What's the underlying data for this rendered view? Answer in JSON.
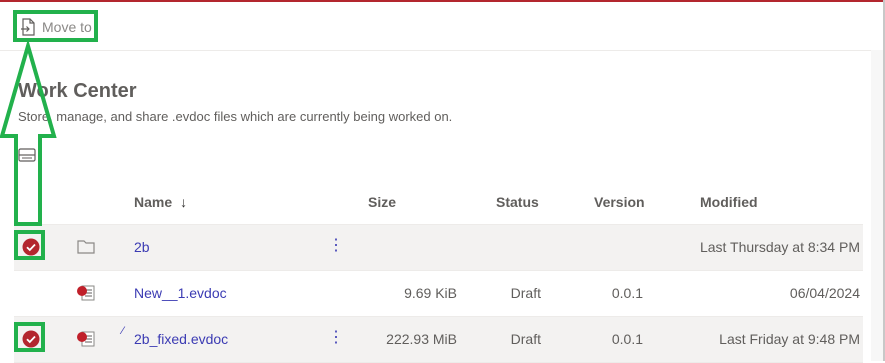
{
  "command_bar": {
    "move_to_label": "Move to"
  },
  "page": {
    "title": "Work Center",
    "subtitle": "Store, manage, and share .evdoc files which are currently being worked on."
  },
  "table": {
    "columns": {
      "name": "Name",
      "size": "Size",
      "status": "Status",
      "version": "Version",
      "modified": "Modified"
    },
    "sort_indicator": "↓",
    "rows": [
      {
        "name": "2b",
        "type": "folder",
        "size": "",
        "status": "",
        "version": "",
        "modified": "Last Thursday at 8:34 PM",
        "selected": true
      },
      {
        "name": "New__1.evdoc",
        "type": "evdoc",
        "size": "9.69 KiB",
        "status": "Draft",
        "version": "0.0.1",
        "modified": "06/04/2024",
        "selected": false
      },
      {
        "name": "2b_fixed.evdoc",
        "type": "evdoc",
        "size": "222.93 MiB",
        "status": "Draft",
        "version": "0.0.1",
        "modified": "Last Friday at 9:48 PM",
        "selected": true
      }
    ]
  },
  "colors": {
    "accent": "#b3262e",
    "link": "#3b3bb3",
    "annotation": "#22b14c"
  },
  "icons": {
    "move": "move-document-icon",
    "folder": "folder-icon",
    "evdoc": "evdoc-file-icon",
    "check": "check-circle-icon",
    "more": "more-vertical-icon",
    "view": "view-toggle-icon"
  }
}
